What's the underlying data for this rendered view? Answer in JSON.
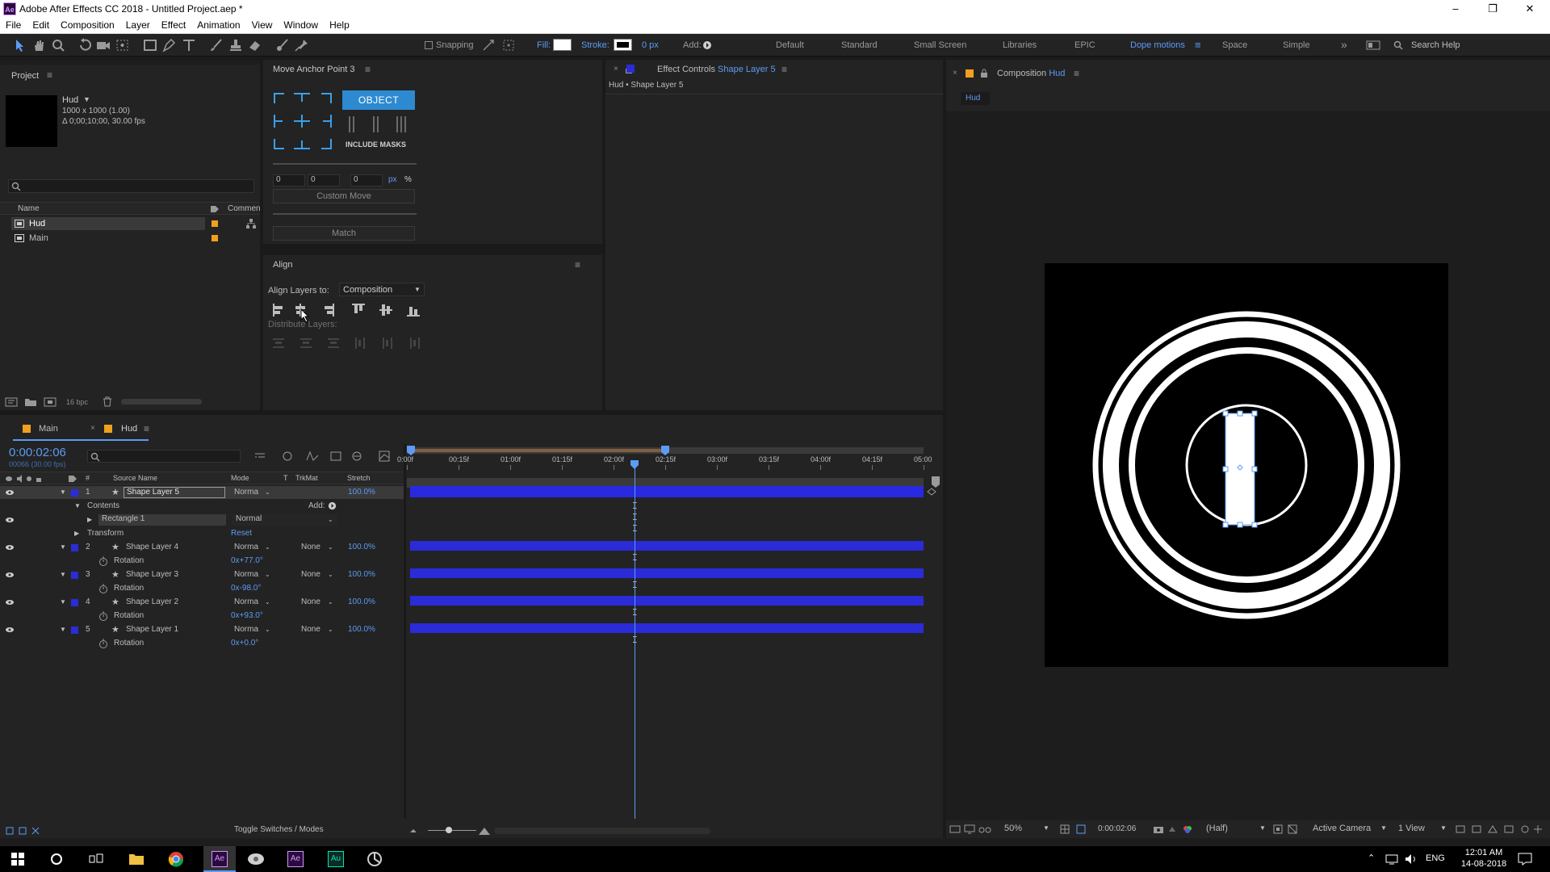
{
  "app": {
    "window_title": "Adobe After Effects CC 2018 - Untitled Project.aep *",
    "app_icon": "Ae"
  },
  "menu": [
    "File",
    "Edit",
    "Composition",
    "Layer",
    "Effect",
    "Animation",
    "View",
    "Window",
    "Help"
  ],
  "toolbar": {
    "snapping": "Snapping",
    "fill": "Fill:",
    "stroke": "Stroke:",
    "stroke_px": "0 px",
    "add": "Add:",
    "workspaces": [
      "Default",
      "Standard",
      "Small Screen",
      "Libraries",
      "EPIC",
      "Dope motions",
      "Space",
      "Simple"
    ],
    "active_workspace": "Dope motions",
    "search_placeholder": "Search Help"
  },
  "project": {
    "title": "Project",
    "comp_name": "Hud",
    "comp_size": "1000 x 1000 (1.00)",
    "comp_duration": "Δ 0;00;10;00, 30.00 fps",
    "col_name": "Name",
    "col_comment": "Commen",
    "items": [
      {
        "name": "Hud",
        "selected": true
      },
      {
        "name": "Main",
        "selected": false
      }
    ],
    "bpc": "16 bpc"
  },
  "anchor_panel": {
    "title": "Move Anchor Point 3",
    "object_btn": "OBJECT",
    "include_masks": "INCLUDE MASKS",
    "x": "0",
    "y": "0",
    "z": "0",
    "unit_px": "px",
    "unit_pct": "%",
    "custom_move": "Custom Move",
    "match": "Match"
  },
  "align": {
    "title": "Align",
    "align_to_label": "Align Layers to:",
    "align_to_value": "Composition",
    "distribute_label": "Distribute Layers:"
  },
  "effect_controls": {
    "title_prefix": "Effect Controls",
    "title_layer": "Shape Layer 5",
    "breadcrumb": "Hud • Shape Layer 5"
  },
  "composition": {
    "title_prefix": "Composition",
    "title_name": "Hud",
    "tab": "Hud",
    "zoom": "50%",
    "timecode": "0:00:02:06",
    "resolution": "(Half)",
    "camera": "Active Camera",
    "views": "1 View"
  },
  "timeline": {
    "tabs": [
      {
        "name": "Main",
        "active": false
      },
      {
        "name": "Hud",
        "active": true
      }
    ],
    "timecode": "0:00:02:06",
    "frame_info": "00066 (30.00 fps)",
    "columns": {
      "source": "Source Name",
      "mode": "Mode",
      "t": "T",
      "trkmat": "TrkMat",
      "stretch": "Stretch",
      "num": "#"
    },
    "ruler": [
      "0:00f",
      "00:15f",
      "01:00f",
      "01:15f",
      "02:00f",
      "02:15f",
      "03:00f",
      "03:15f",
      "04:00f",
      "04:15f",
      "05:00"
    ],
    "playhead_seconds": 2.2,
    "work_area_end_seconds": 2.5,
    "layers": [
      {
        "num": "1",
        "name": "Shape Layer 5",
        "mode": "Norma",
        "trkmat": "",
        "stretch": "100.0%",
        "selected": true,
        "children": [
          {
            "label": "Contents",
            "extra": "Add:"
          },
          {
            "label": "Rectangle 1",
            "mode": "Normal"
          },
          {
            "label": "Transform",
            "value": "Reset"
          }
        ]
      },
      {
        "num": "2",
        "name": "Shape Layer 4",
        "mode": "Norma",
        "trkmat": "None",
        "stretch": "100.0%",
        "prop": "Rotation",
        "value": "0x+77.0°"
      },
      {
        "num": "3",
        "name": "Shape Layer 3",
        "mode": "Norma",
        "trkmat": "None",
        "stretch": "100.0%",
        "prop": "Rotation",
        "value": "0x-98.0°"
      },
      {
        "num": "4",
        "name": "Shape Layer 2",
        "mode": "Norma",
        "trkmat": "None",
        "stretch": "100.0%",
        "prop": "Rotation",
        "value": "0x+93.0°"
      },
      {
        "num": "5",
        "name": "Shape Layer 1",
        "mode": "Norma",
        "trkmat": "None",
        "stretch": "100.0%",
        "prop": "Rotation",
        "value": "0x+0.0°"
      }
    ],
    "toggle_switches": "Toggle Switches / Modes"
  },
  "taskbar": {
    "lang": "ENG",
    "time": "12:01 AM",
    "date": "14-08-2018"
  },
  "colors": {
    "accent_blue": "#5d9bf5",
    "layer_bar": "#2b2bd8",
    "label_orange": "#f0a020",
    "object_btn": "#2d8ad0"
  }
}
